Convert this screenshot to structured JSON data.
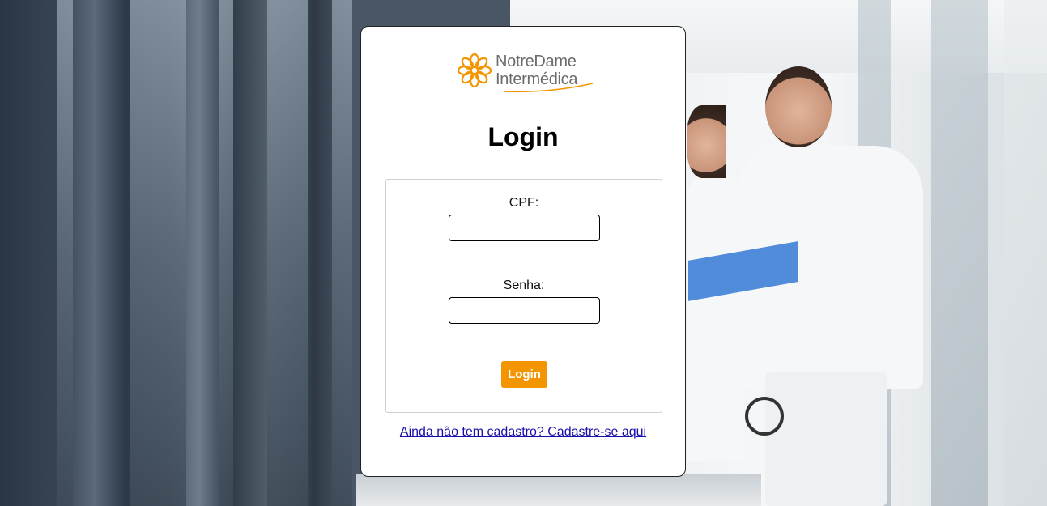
{
  "brand": {
    "line1": "NotreDame",
    "line2": "Intermédica",
    "color_orange": "#f39500",
    "color_gray": "#6b6b6b",
    "icon": "flower-logo-icon"
  },
  "login": {
    "title": "Login",
    "cpf_label": "CPF:",
    "cpf_value": "",
    "senha_label": "Senha:",
    "senha_value": "",
    "button_label": "Login",
    "signup_link": "Ainda não tem cadastro? Cadastre-se aqui"
  },
  "colors": {
    "link": "#1a0dab",
    "card_bg": "#ffffff"
  }
}
